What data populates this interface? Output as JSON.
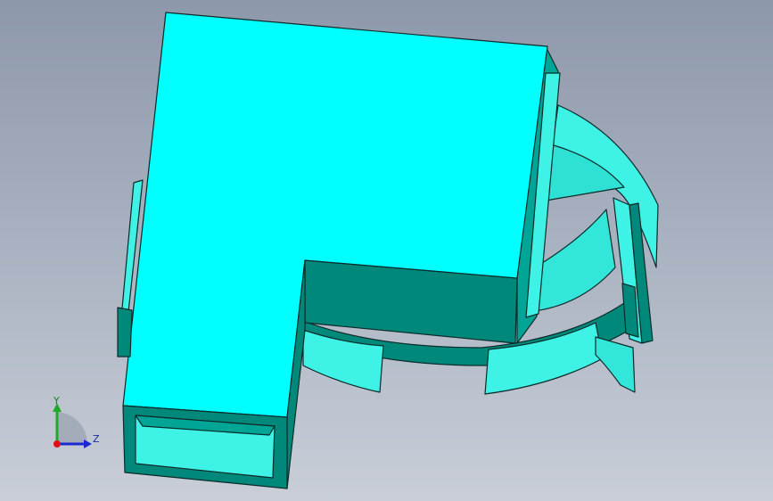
{
  "viewport": {
    "background_top": "#8d98aa",
    "background_bottom": "#c9ced8"
  },
  "model": {
    "top_face_color": "#00ffff",
    "side_face_color": "#00897b",
    "light_face_color": "#3ef2e6",
    "edge_color": "#0b2a28"
  },
  "triad": {
    "y_label": "Y",
    "z_label": "Z",
    "y_color": "#1faa2a",
    "z_color": "#1a2ad0",
    "origin_color": "#e01010"
  }
}
